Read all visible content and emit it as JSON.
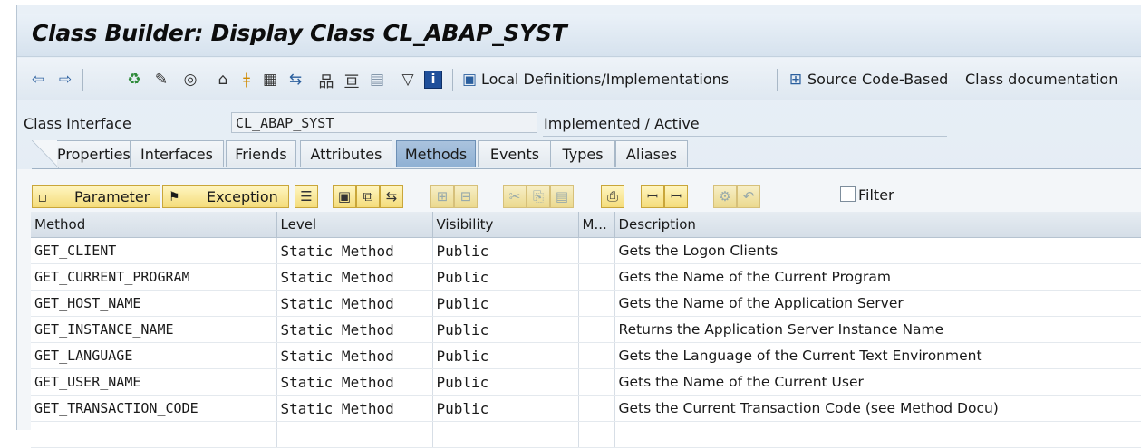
{
  "window": {
    "title": "Class Builder: Display Class CL_ABAP_SYST"
  },
  "toolbar": {
    "icons": [
      "back-arrow-icon",
      "forward-arrow-icon",
      "other-object-icon",
      "display-change-icon",
      "activate-icon",
      "check-icon",
      "test-icon",
      "where-used-icon",
      "navigate-icon",
      "object-list-icon",
      "hierarchy-icon",
      "display-object-icon",
      "filter-icon",
      "info-icon"
    ],
    "local_definitions_label": "Local Definitions/Implementations",
    "source_code_label": "Source Code-Based",
    "class_doc_label": "Class documentation"
  },
  "class_interface": {
    "label": "Class Interface",
    "value": "CL_ABAP_SYST",
    "status": "Implemented / Active"
  },
  "tabs": [
    "Properties",
    "Interfaces",
    "Friends",
    "Attributes",
    "Methods",
    "Events",
    "Types",
    "Aliases"
  ],
  "active_tab": "Methods",
  "methods_toolbar": {
    "parameter_label": "Parameter",
    "exception_label": "Exception",
    "filter_label": "Filter"
  },
  "grid": {
    "columns": [
      "Method",
      "Level",
      "Visibility",
      "M...",
      "Description"
    ],
    "rows": [
      [
        "GET_CLIENT",
        "Static Method",
        "Public",
        "",
        "Gets the Logon Clients"
      ],
      [
        "GET_CURRENT_PROGRAM",
        "Static Method",
        "Public",
        "",
        "Gets the Name of the Current Program"
      ],
      [
        "GET_HOST_NAME",
        "Static Method",
        "Public",
        "",
        "Gets the Name of the Application Server"
      ],
      [
        "GET_INSTANCE_NAME",
        "Static Method",
        "Public",
        "",
        "Returns the Application Server Instance Name"
      ],
      [
        "GET_LANGUAGE",
        "Static Method",
        "Public",
        "",
        "Gets the Language of the Current Text Environment"
      ],
      [
        "GET_USER_NAME",
        "Static Method",
        "Public",
        "",
        "Gets the Name of the Current User"
      ],
      [
        "GET_TRANSACTION_CODE",
        "Static Method",
        "Public",
        "",
        "Gets the Current Transaction Code (see Method Docu)"
      ]
    ]
  },
  "colors": {
    "active_tab": "#8fb0d3",
    "button_yellow": "#f4dc7a",
    "frame": "#dfe8f1"
  }
}
